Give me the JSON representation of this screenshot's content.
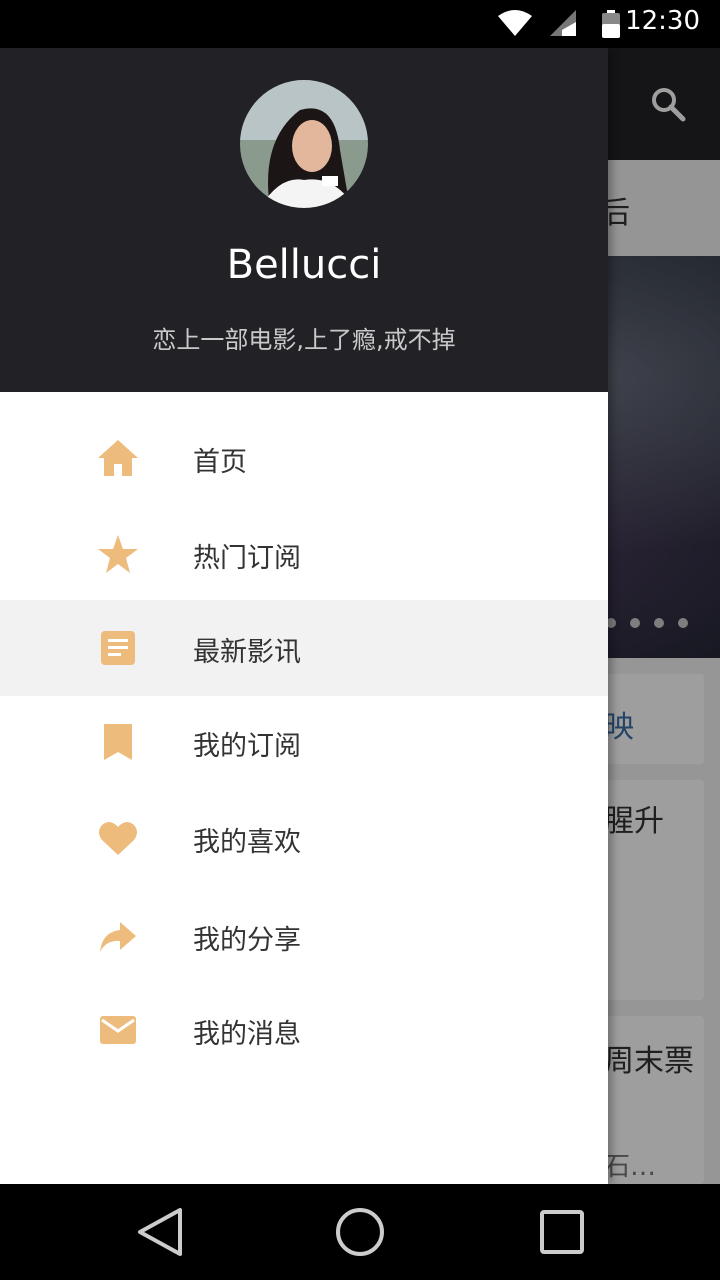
{
  "status_bar": {
    "time": "12:30",
    "icons": [
      "wifi-icon",
      "signal-icon",
      "battery-icon"
    ]
  },
  "background_app": {
    "tab_text": "后",
    "card_texts": [
      "映",
      "腥升",
      "周末票",
      "石…"
    ],
    "search_icon": "search-icon"
  },
  "drawer": {
    "header": {
      "username": "Bellucci",
      "tagline": "恋上一部电影,上了瘾,戒不掉"
    },
    "menu_items": [
      {
        "label": "首页",
        "icon": "home-icon"
      },
      {
        "label": "热门订阅",
        "icon": "star-icon"
      },
      {
        "label": "最新影讯",
        "icon": "article-icon"
      },
      {
        "label": "我的订阅",
        "icon": "bookmark-icon"
      },
      {
        "label": "我的喜欢",
        "icon": "heart-icon"
      },
      {
        "label": "我的分享",
        "icon": "share-icon"
      },
      {
        "label": "我的消息",
        "icon": "mail-icon"
      }
    ],
    "active_item": "最新影讯",
    "accent_color": "#EDBB7C"
  },
  "nav_bar": {
    "buttons": [
      "back-icon",
      "home-circle-icon",
      "recents-icon"
    ]
  }
}
